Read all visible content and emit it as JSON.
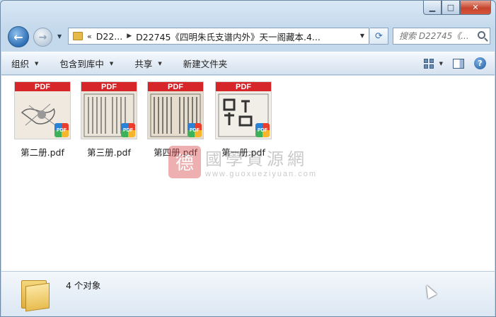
{
  "window": {
    "caption": {
      "minimize": "▁",
      "maximize": "□",
      "close": "✕"
    }
  },
  "address": {
    "chevrons": "«",
    "segments": [
      "D22...",
      "D22745《四明朱氏支谱内外》天一阁藏本.4..."
    ],
    "refresh_symbol": "⟳"
  },
  "search": {
    "placeholder": "搜索 D22745《..."
  },
  "toolbar": {
    "items": [
      "组织",
      "包含到库中",
      "共享",
      "新建文件夹"
    ],
    "help": "?"
  },
  "files": [
    {
      "name": "第二册.pdf",
      "badge": "PDF",
      "band": "PDF"
    },
    {
      "name": "第三册.pdf",
      "badge": "PDF",
      "band": "PDF"
    },
    {
      "name": "第四册.pdf",
      "badge": "PDF",
      "band": "PDF"
    },
    {
      "name": "第一册.pdf",
      "badge": "PDF",
      "band": "PDF"
    }
  ],
  "watermark": {
    "seal": "德",
    "title": "國學資源網",
    "url": "www.guoxueziyuan.com"
  },
  "details": {
    "count": "4 个对象"
  },
  "colors": {
    "pdf_band": "#d7262a",
    "folder": "#e6b94a",
    "accent": "#2f6fb4"
  }
}
